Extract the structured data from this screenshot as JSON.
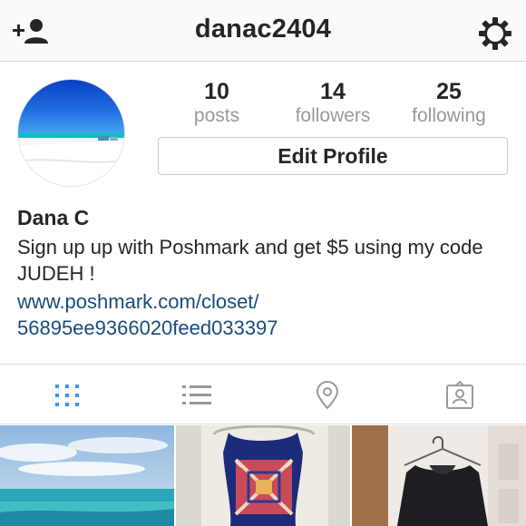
{
  "header": {
    "username": "danac2404",
    "add_user_icon": "add-user-icon",
    "settings_icon": "gear-icon"
  },
  "stats": [
    {
      "value": "10",
      "label": "posts"
    },
    {
      "value": "14",
      "label": "followers"
    },
    {
      "value": "25",
      "label": "following"
    }
  ],
  "edit_profile_label": "Edit Profile",
  "bio": {
    "name": "Dana C",
    "text": "Sign up up with Poshmark and get $5 using my code JUDEH !",
    "link_line1": "www.poshmark.com/closet/",
    "link_line2": "56895ee9366020feed033397"
  },
  "tabs": [
    {
      "icon": "grid-icon",
      "active": true
    },
    {
      "icon": "list-icon",
      "active": false
    },
    {
      "icon": "location-pin-icon",
      "active": false
    },
    {
      "icon": "tagged-person-icon",
      "active": false
    }
  ],
  "colors": {
    "active_tab": "#3897f0",
    "inactive_tab": "#999999",
    "link": "#1b4a7a",
    "muted_text": "#999999"
  }
}
